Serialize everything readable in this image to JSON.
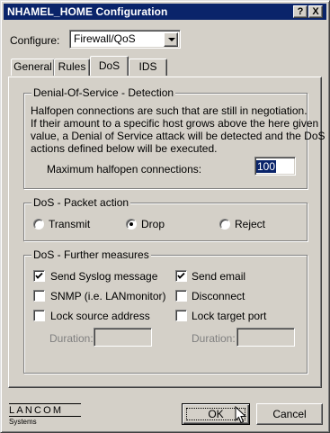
{
  "window": {
    "title": "NHAMEL_HOME Configuration"
  },
  "titlebar_buttons": {
    "help": "?",
    "close": "X"
  },
  "configure": {
    "label": "Configure:",
    "value": "Firewall/QoS"
  },
  "tabs": [
    {
      "label": "General",
      "active": false
    },
    {
      "label": "Rules",
      "active": false
    },
    {
      "label": "DoS",
      "active": true
    },
    {
      "label": "IDS",
      "active": false
    }
  ],
  "dos_detection": {
    "title": "Denial-Of-Service - Detection",
    "description": [
      "Halfopen connections are such that are still in negotiation.",
      "If their amount to a specific host grows above the here given",
      "value, a Denial of Service attack will be detected and the DoS",
      "actions defined below will be executed."
    ],
    "max_halfopen_label": "Maximum halfopen connections:",
    "max_halfopen_value": "100"
  },
  "packet_action": {
    "title": "DoS - Packet action",
    "options": [
      {
        "label": "Transmit",
        "selected": false
      },
      {
        "label": "Drop",
        "selected": true
      },
      {
        "label": "Reject",
        "selected": false
      }
    ]
  },
  "further_measures": {
    "title": "DoS - Further measures",
    "left": [
      {
        "label": "Send Syslog message",
        "checked": true
      },
      {
        "label": "SNMP (i.e. LANmonitor)",
        "checked": false
      },
      {
        "label": "Lock source address",
        "checked": false
      }
    ],
    "right": [
      {
        "label": "Send email",
        "checked": true
      },
      {
        "label": "Disconnect",
        "checked": false
      },
      {
        "label": "Lock target port",
        "checked": false
      }
    ],
    "duration_label": "Duration:",
    "duration_left_value": "",
    "duration_right_value": ""
  },
  "footer": {
    "logo_text": "LANCOM",
    "logo_sub": "Systems",
    "ok_label": "OK",
    "cancel_label": "Cancel"
  }
}
